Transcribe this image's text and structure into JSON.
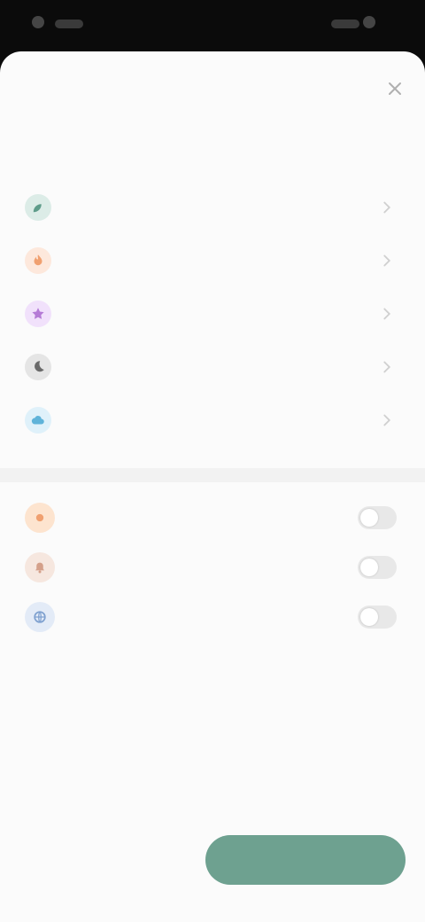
{
  "status_bar": {
    "left": "",
    "right": ""
  },
  "header": {
    "title": "",
    "close_label": ""
  },
  "sections": [
    {
      "title": "",
      "items": [
        {
          "label": "",
          "icon": "leaf-icon",
          "color": "#5f9c8a"
        },
        {
          "label": "",
          "icon": "flame-icon",
          "color": "#f0a070"
        },
        {
          "label": "",
          "icon": "star-icon",
          "color": "#b57bd6"
        },
        {
          "label": "",
          "icon": "moon-icon",
          "color": "#6a6a6a"
        },
        {
          "label": "",
          "icon": "cloud-icon",
          "color": "#5fb3d9"
        }
      ]
    }
  ],
  "preferences": [
    {
      "label": "",
      "icon": "sun-icon",
      "color": "#f0a070"
    },
    {
      "label": "",
      "icon": "bell-icon",
      "color": "#d4a08a"
    },
    {
      "label": "",
      "icon": "globe-icon",
      "color": "#7ea0cf"
    }
  ],
  "description": {
    "title": "",
    "rows": [
      "",
      ""
    ]
  },
  "footer": {
    "link_label": "",
    "primary_label": ""
  }
}
